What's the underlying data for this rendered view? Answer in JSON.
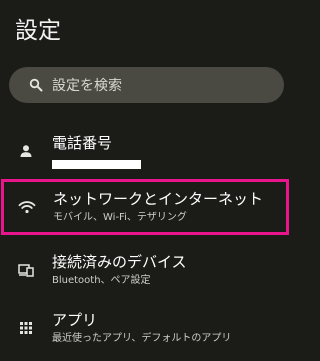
{
  "header": {
    "title": "設定"
  },
  "search": {
    "placeholder": "設定を検索",
    "icon": "search-icon"
  },
  "items": [
    {
      "icon": "person-icon",
      "title": "電話番号",
      "subtitle": "",
      "subtitle_redacted": true
    },
    {
      "icon": "wifi-icon",
      "title": "ネットワークとインターネット",
      "subtitle": "モバイル、Wi-Fi、テザリング",
      "highlighted": true,
      "highlight_color": "#e8158c"
    },
    {
      "icon": "connected-devices-icon",
      "title": "接続済みのデバイス",
      "subtitle": "Bluetooth、ペア設定"
    },
    {
      "icon": "apps-grid-icon",
      "title": "アプリ",
      "subtitle": "最近使ったアプリ、デフォルトのアプリ"
    }
  ],
  "colors": {
    "background": "#1b1b18",
    "search_background": "#4a4a42",
    "highlight": "#e8158c"
  }
}
